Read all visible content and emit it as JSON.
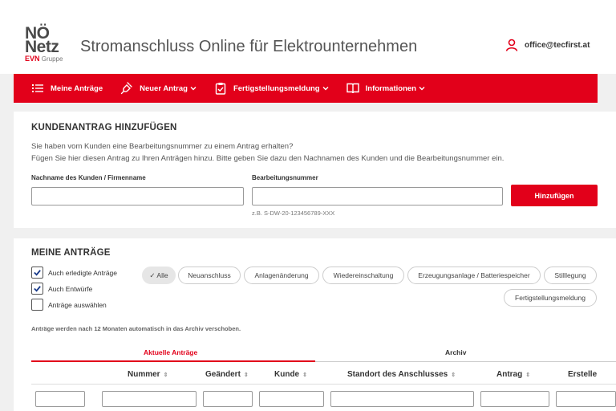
{
  "header": {
    "logo_line1": "NÖ",
    "logo_line2": "Netz",
    "logo_brand": "EVN",
    "logo_group": "Gruppe",
    "title": "Stromanschluss Online für Elektrounternehmen",
    "user_email": "office@tecfirst.at"
  },
  "nav": {
    "items": [
      {
        "label": "Meine Anträge",
        "icon": "list-icon"
      },
      {
        "label": "Neuer Antrag",
        "icon": "plug-icon"
      },
      {
        "label": "Fertigstellungsmeldung",
        "icon": "clipboard-check-icon"
      },
      {
        "label": "Informationen",
        "icon": "book-icon"
      }
    ]
  },
  "add_request": {
    "heading": "KUNDENANTRAG HINZUFÜGEN",
    "text1": "Sie haben vom Kunden eine Bearbeitungsnummer zu einem Antrag erhalten?",
    "text2": "Fügen Sie hier diesen Antrag zu Ihren Anträgen hinzu. Bitte geben Sie dazu den Nachnamen des Kunden und die Bearbeitungsnummer ein.",
    "name_label": "Nachname des Kunden / Firmenname",
    "name_value": "",
    "number_label": "Bearbeitungsnummer",
    "number_value": "",
    "number_hint": "z.B. S-DW-20-123456789-XXX",
    "submit_label": "Hinzufügen"
  },
  "my_requests": {
    "heading": "MEINE ANTRÄGE",
    "checkboxes": [
      {
        "label": "Auch erledigte Anträge",
        "checked": true
      },
      {
        "label": "Auch Entwürfe",
        "checked": true
      },
      {
        "label": "Anträge auswählen",
        "checked": false
      }
    ],
    "chips": [
      {
        "label": "✓ Alle",
        "active": true
      },
      {
        "label": "Neuanschluss",
        "active": false
      },
      {
        "label": "Anlagenänderung",
        "active": false
      },
      {
        "label": "Wiedereinschaltung",
        "active": false
      },
      {
        "label": "Erzeugungsanlage / Batteriespeicher",
        "active": false
      },
      {
        "label": "Stilllegung",
        "active": false
      },
      {
        "label": "Fertigstellungsmeldung",
        "active": false
      }
    ],
    "archive_note": "Anträge werden nach 12 Monaten automatisch in das Archiv verschoben.",
    "tabs": [
      {
        "label": "Aktuelle Anträge",
        "active": true
      },
      {
        "label": "Archiv",
        "active": false
      }
    ],
    "columns": [
      "Nummer",
      "Geändert",
      "Kunde",
      "Standort des Anschlusses",
      "Antrag",
      "Erstelle"
    ],
    "sort_glyph": "⇕"
  },
  "colors": {
    "accent": "#e2001a",
    "background": "#f0f0f0",
    "text": "#333333"
  }
}
